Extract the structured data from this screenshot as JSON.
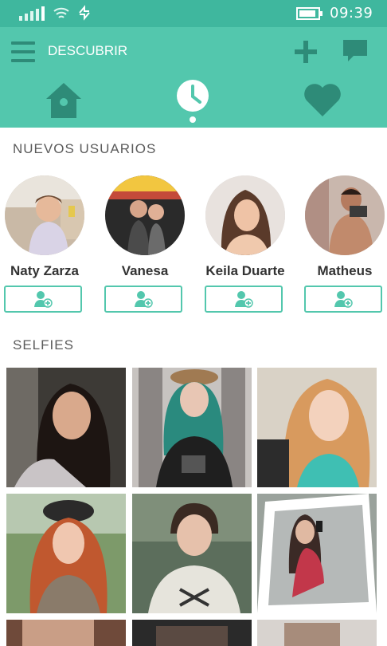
{
  "status": {
    "time": "09:39"
  },
  "header": {
    "title": "DESCUBRIR"
  },
  "tabs": [
    "home-icon",
    "clock-icon",
    "heart-icon"
  ],
  "sections": {
    "new_users": "NUEVOS USUARIOS",
    "selfies": "SELFIES"
  },
  "users": [
    {
      "name": "Naty Zarza"
    },
    {
      "name": "Vanesa"
    },
    {
      "name": "Keila Duarte"
    },
    {
      "name": "Matheus"
    }
  ],
  "colors": {
    "status_bar": "#3fb79e",
    "app_bar": "#53c7ad",
    "accent": "#53c7ad"
  }
}
